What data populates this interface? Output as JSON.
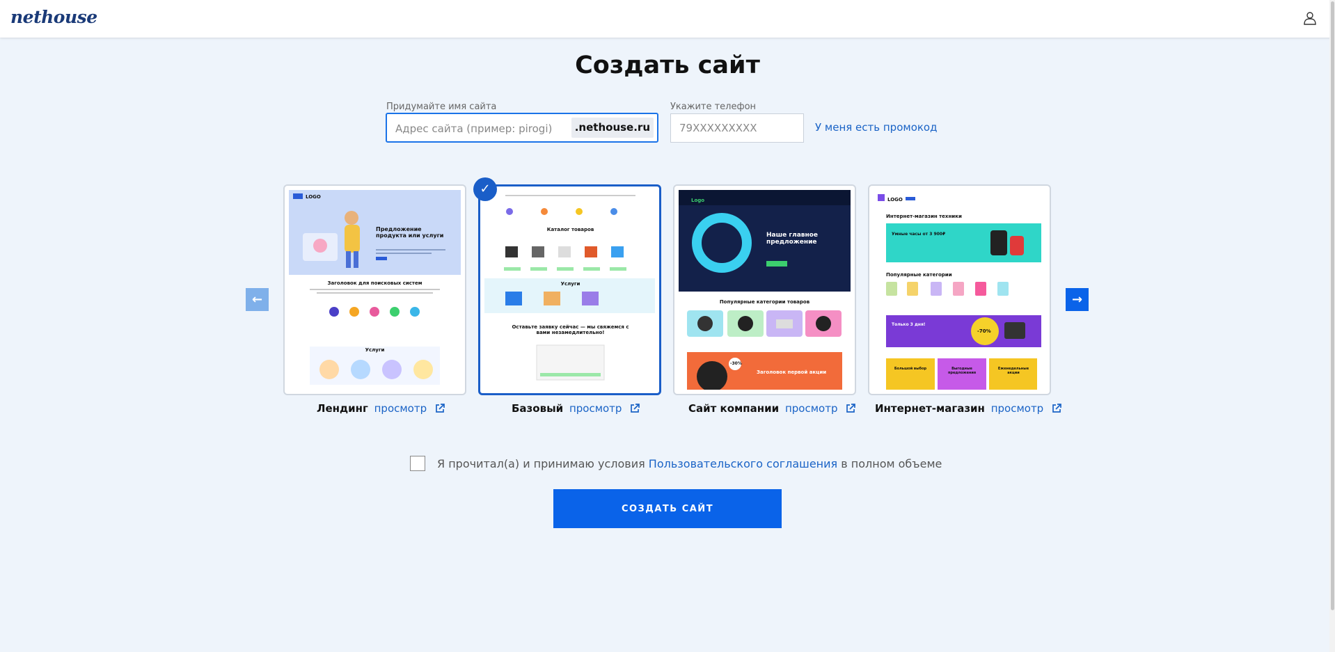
{
  "header": {
    "logo": "nethouse",
    "user_icon": "user-icon"
  },
  "page": {
    "title": "Создать сайт"
  },
  "form": {
    "name_label": "Придумайте имя сайта",
    "name_placeholder": "Адрес сайта (пример: pirogi)",
    "name_value": "",
    "domain_suffix": ".nethouse.ru",
    "phone_label": "Укажите телефон",
    "phone_placeholder": "79XXXXXXXXX",
    "phone_value": "",
    "promo_link": "У меня есть промокод"
  },
  "carousel": {
    "prev_icon": "arrow-left-icon",
    "next_icon": "arrow-right-icon",
    "prev_symbol": "←",
    "next_symbol": "→",
    "selected_index": 1,
    "check_symbol": "✓",
    "templates": [
      {
        "name": "Лендинг",
        "view": "просмотр",
        "preview": {
          "logo": "LOGO",
          "hero": "Предложение продукта или услуги",
          "section": "Заголовок для поисковых систем",
          "services": "Услуги"
        }
      },
      {
        "name": "Базовый",
        "view": "просмотр",
        "preview": {
          "catalog": "Каталог товаров",
          "services": "Услуги",
          "cta": "Оставьте заявку сейчас — мы свяжемся с вами незамедлительно!"
        }
      },
      {
        "name": "Сайт компании",
        "view": "просмотр",
        "preview": {
          "logo": "Logo",
          "hero": "Наше главное предложение",
          "section": "Популярные категории товаров",
          "promo": "Заголовок первой акции",
          "badge": "-30%"
        }
      },
      {
        "name": "Интернет-магазин",
        "view": "просмотр",
        "preview": {
          "logo": "LOGO",
          "title": "Интернет-магазин техники",
          "banner": "Умные часы от 3 900₽",
          "section": "Популярные категории",
          "promo": "Только 3 дня!",
          "badge": "-70%",
          "tiles": [
            "Большой выбор",
            "Выгодные предложения",
            "Еженедельные акции"
          ]
        }
      }
    ]
  },
  "agreement": {
    "prefix": "Я прочитал(а) и принимаю условия ",
    "link": "Пользовательского соглашения",
    "suffix": " в полном объеме"
  },
  "submit": {
    "label": "СОЗДАТЬ САЙТ"
  },
  "colors": {
    "accent": "#0a63e9",
    "background": "#eef4fb",
    "link": "#1a63c6",
    "logo": "#1a3a78"
  }
}
